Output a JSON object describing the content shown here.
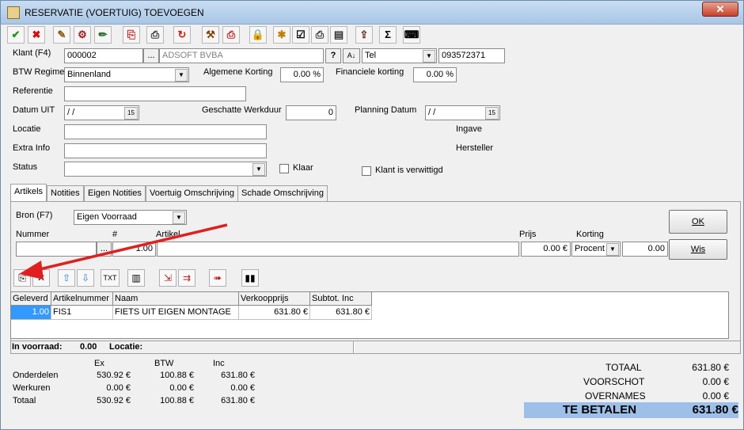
{
  "window": {
    "title": "RESERVATIE (VOERTUIG) TOEVOEGEN",
    "close_label": "✕"
  },
  "toolbar": {
    "buttons": [
      {
        "icon": "checkmark-icon",
        "glyph": "✔",
        "color": "#1a9a1a"
      },
      {
        "icon": "cancel-x-icon",
        "glyph": "✖",
        "color": "#d01010"
      },
      {
        "icon": "edit-icon",
        "glyph": "✎",
        "color": "#8a5a10"
      },
      {
        "icon": "tools-icon",
        "glyph": "⚙",
        "color": "#a02020"
      },
      {
        "icon": "pencil-icon",
        "glyph": "✏",
        "color": "#2a6a2a"
      },
      {
        "icon": "document-add-icon",
        "glyph": "⎘",
        "color": "#c02020"
      },
      {
        "icon": "printer-icon",
        "glyph": "⎙",
        "color": "#333"
      },
      {
        "icon": "refresh-icon",
        "glyph": "↻",
        "color": "#d02010"
      },
      {
        "icon": "hammer-icon",
        "glyph": "⚒",
        "color": "#804000"
      },
      {
        "icon": "print-preview-icon",
        "glyph": "⎙",
        "color": "#c02020"
      },
      {
        "icon": "lock-icon",
        "glyph": "🔒",
        "color": "#806000"
      },
      {
        "icon": "new-document-icon",
        "glyph": "✱",
        "color": "#c08000"
      },
      {
        "icon": "checklist-icon",
        "glyph": "☑",
        "color": "#000"
      },
      {
        "icon": "print-icon",
        "glyph": "⎙",
        "color": "#333"
      },
      {
        "icon": "print-list-icon",
        "glyph": "▤",
        "color": "#333"
      },
      {
        "icon": "export-icon",
        "glyph": "⇪",
        "color": "#603020"
      },
      {
        "icon": "sum-icon",
        "glyph": "Σ",
        "color": "#000"
      },
      {
        "icon": "keyboard-icon",
        "glyph": "⌨",
        "color": "#000"
      }
    ]
  },
  "form": {
    "klant_label": "Klant (F4)",
    "klant_value": "000002",
    "klant_name": "ADSOFT BVBA",
    "tel_select": "Tel",
    "tel_value": "093572371",
    "btw_label": "BTW Regime",
    "btw_value": "Binnenland",
    "alg_korting_label": "Algemene Korting",
    "alg_korting_value": "0.00 %",
    "fin_korting_label": "Financiele korting",
    "fin_korting_value": "0.00 %",
    "referentie_label": "Referentie",
    "referentie_value": "",
    "datum_uit_label": "Datum UIT",
    "datum_uit_value": "/ /",
    "werkduur_label": "Geschatte Werkduur",
    "werkduur_value": "0",
    "planning_label": "Planning Datum",
    "planning_value": "/ /",
    "locatie_label": "Locatie",
    "ingave_label": "Ingave",
    "extra_info_label": "Extra Info",
    "hersteller_label": "Hersteller",
    "status_label": "Status",
    "klaar_label": "Klaar",
    "verwittigd_label": "Klant is verwittigd",
    "ellipsis": "...",
    "calendar_glyph": "15"
  },
  "tabs": [
    {
      "label": "Artikels",
      "active": true
    },
    {
      "label": "Notities",
      "active": false
    },
    {
      "label": "Eigen Notities",
      "active": false
    },
    {
      "label": "Voertuig Omschrijving",
      "active": false
    },
    {
      "label": "Schade Omschrijving",
      "active": false
    }
  ],
  "artikels": {
    "bron_label": "Bron (F7)",
    "bron_value": "Eigen Voorraad",
    "nummer_label": "Nummer",
    "hash_label": "#",
    "artikel_label": "Artikel",
    "prijs_label": "Prijs",
    "korting_label": "Korting",
    "qty_value": "1.00",
    "prijs_value": "0.00 €",
    "korting_type": "Procent",
    "korting_value": "0.00",
    "ok_label": "OK",
    "wis_label": "Wis",
    "txt_label": "TXT"
  },
  "grid": {
    "headers": [
      "Geleverd",
      "Artikelnummer",
      "Naam",
      "Verkoopprijs",
      "Subtot. Inc"
    ],
    "rows": [
      [
        "1.00",
        "FIS1",
        "FIETS UIT EIGEN MONTAGE",
        "631.80 €",
        "631.80 €"
      ]
    ]
  },
  "stock": {
    "voorraad_label": "In voorraad:",
    "voorraad_value": "0.00",
    "locatie_label": "Locatie:"
  },
  "summary": {
    "col_headers": [
      "Ex",
      "BTW",
      "Inc"
    ],
    "rows": [
      {
        "label": "Onderdelen",
        "ex": "530.92 €",
        "btw": "100.88 €",
        "inc": "631.80 €"
      },
      {
        "label": "Werkuren",
        "ex": "0.00 €",
        "btw": "0.00 €",
        "inc": "0.00 €"
      },
      {
        "label": "Totaal",
        "ex": "530.92 €",
        "btw": "100.88 €",
        "inc": "631.80 €"
      }
    ]
  },
  "totals": {
    "totaal_label": "TOTAAL",
    "totaal_value": "631.80 €",
    "voorschot_label": "VOORSCHOT",
    "voorschot_value": "0.00 €",
    "overnames_label": "OVERNAMES",
    "overnames_value": "0.00 €",
    "te_betalen_label": "TE BETALEN",
    "te_betalen_value": "631.80 €"
  },
  "colors": {
    "annotation_arrow": "#e02020",
    "selected_cell": "#3399ff",
    "te_betalen_bar": "#9ec0e8"
  }
}
